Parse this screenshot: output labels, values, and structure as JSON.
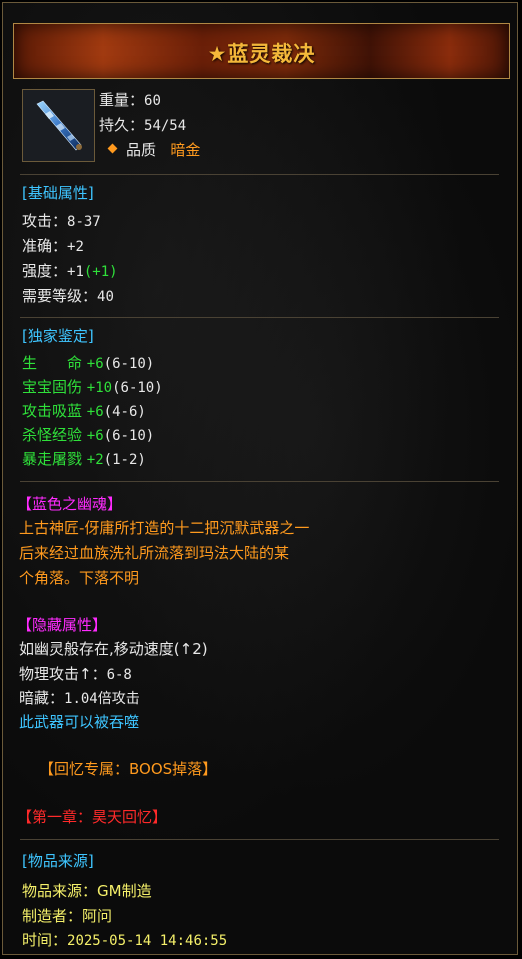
{
  "header": {
    "title": "★蓝灵裁决"
  },
  "item": {
    "icon": "blue-sword-icon",
    "weight_label": "重量：",
    "weight_value": "60",
    "durability_label": "持久：",
    "durability_value": "54/54",
    "quality_label": "品质",
    "quality_value": "暗金"
  },
  "basic": {
    "title": "[基础属性]",
    "attack_label": "攻击：",
    "attack_value": "8-37",
    "accuracy_label": "准确：",
    "accuracy_value": "+2",
    "strength_label": "强度：",
    "strength_value": "+1",
    "strength_bonus": "(+1)",
    "level_label": "需要等级：",
    "level_value": "40"
  },
  "exclusive": {
    "title": "[独家鉴定]",
    "rows": [
      {
        "label": "生　　命",
        "value": "+6",
        "range": "(6-10)"
      },
      {
        "label": "宝宝固伤",
        "value": "+10",
        "range": "(6-10)"
      },
      {
        "label": "攻击吸蓝",
        "value": "+6",
        "range": "(4-6)"
      },
      {
        "label": "杀怪经验",
        "value": "+6",
        "range": "(6-10)"
      },
      {
        "label": "暴走屠戮",
        "value": "+2",
        "range": "(1-2)"
      }
    ]
  },
  "lore": {
    "title": "【蓝色之幽魂】",
    "line1": "上古神匠-伢庸所打造的十二把沉默武器之一",
    "line2": "后来经过血族洗礼所流落到玛法大陆的某",
    "line3": "个角落。下落不明"
  },
  "hidden": {
    "title": "【隐藏属性】",
    "line1": "如幽灵般存在,移动速度(↑2)",
    "line2_label": "物理攻击↑：",
    "line2_value": "6-8",
    "line3_label": "暗藏：",
    "line3_value": "1.04倍攻击",
    "line4": "此武器可以被吞噬"
  },
  "memory": {
    "text": "【回忆专属：BOOS掉落】"
  },
  "chapter": {
    "text": "【第一章：昊天回忆】"
  },
  "source": {
    "title": "[物品来源]",
    "origin_label": "物品来源：",
    "origin_value": "GM制造",
    "maker_label": "制造者：",
    "maker_value": "阿问",
    "time_label": "时间：",
    "time_value": "2025-05-14 14:46:55"
  },
  "colors": {
    "title": "#f4b83a",
    "section": "#3ec5ff",
    "bonus": "#2fe03a",
    "lore": "#ff2bff",
    "chapter": "#ff2a2a",
    "quality": "#ff9a1e",
    "source": "#f5f06a"
  }
}
